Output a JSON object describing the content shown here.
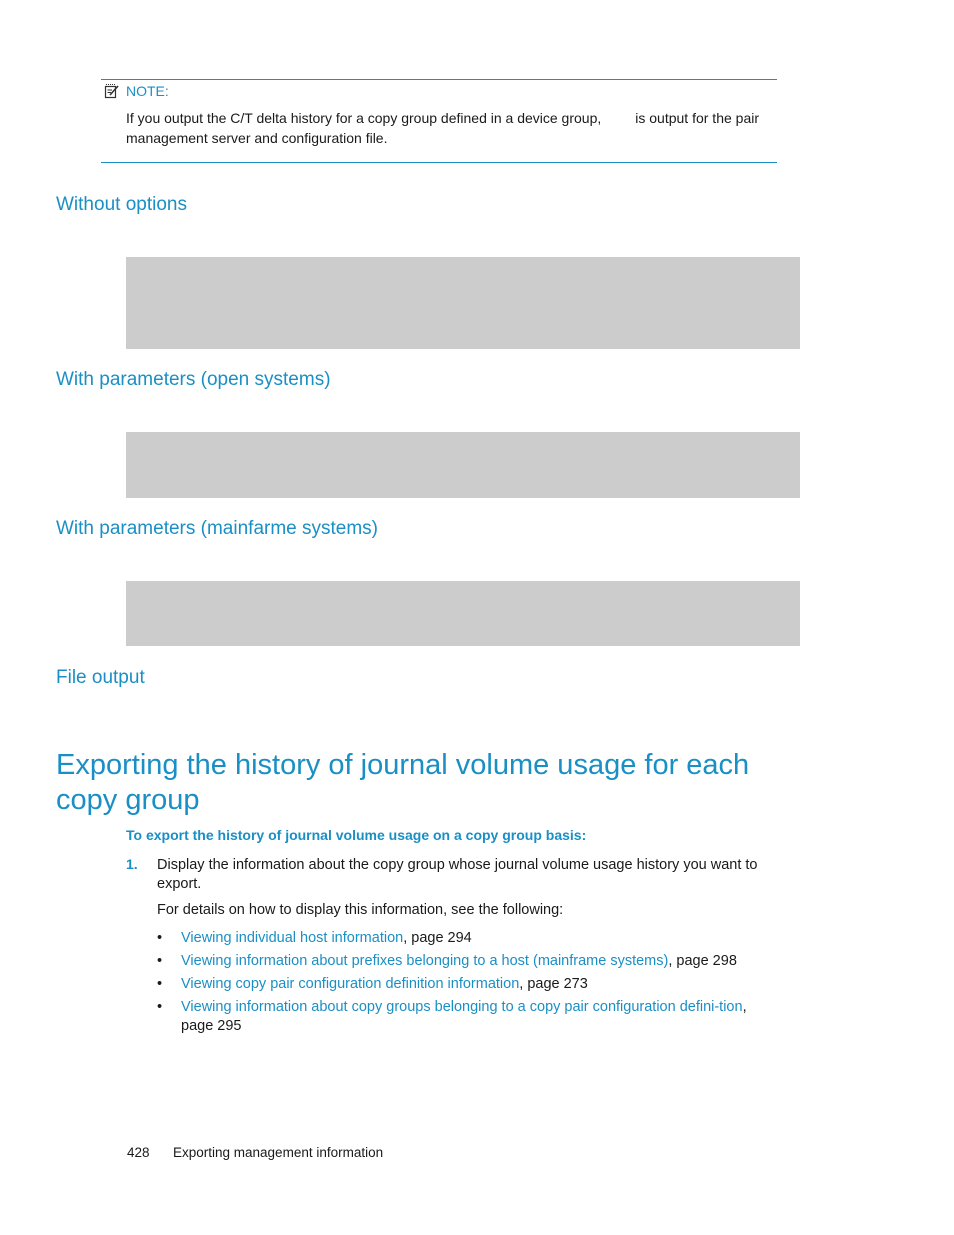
{
  "note": {
    "label": "NOTE:",
    "icon": "note-pencil-icon",
    "text_before_gap": "If you output the C/T delta history for a copy group defined in a device group,",
    "text_after_gap": "is output for the pair management server and configuration file."
  },
  "sections": [
    {
      "heading": "Without options"
    },
    {
      "heading": "With parameters (open systems)"
    },
    {
      "heading": "With parameters (mainfarme systems)"
    },
    {
      "heading": "File output"
    }
  ],
  "main": {
    "title": "Exporting the history of journal volume usage for each copy group",
    "procedure_title": "To export the history of journal volume usage on a copy group basis:",
    "step1": {
      "number": "1.",
      "text": "Display the information about the copy group whose journal volume usage history you want to export.",
      "sub": "For details on how to display this information, see the following:"
    },
    "bullets": [
      {
        "link": "Viewing individual host information",
        "suffix": ", page 294"
      },
      {
        "link": "Viewing information about prefixes belonging to a host (mainframe systems)",
        "suffix": ", page 298"
      },
      {
        "link": "Viewing copy pair configuration definition information",
        "suffix": ", page 273"
      },
      {
        "link": "Viewing information about copy groups belonging to a copy pair configuration defini-tion",
        "suffix": ", page 295"
      }
    ]
  },
  "footer": {
    "page_number": "428",
    "chapter": "Exporting management information"
  }
}
